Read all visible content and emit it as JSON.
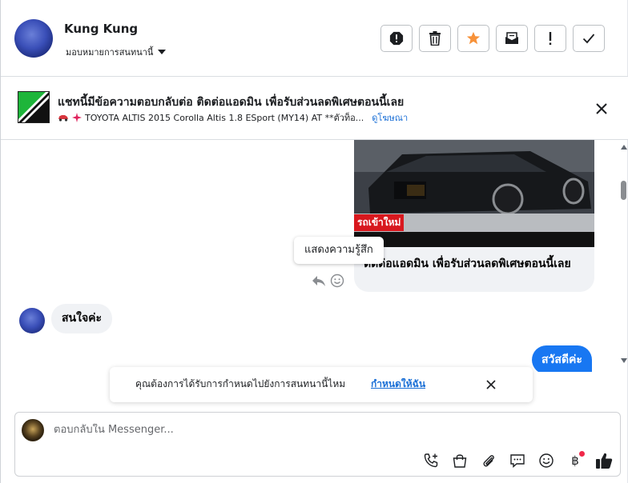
{
  "header": {
    "contact_name": "Kung Kung",
    "assign_label": "มอบหมายการสนทนานี้",
    "tools": [
      "alert-icon",
      "trash-icon",
      "star-icon",
      "mail-icon",
      "exclamation-icon",
      "check-icon"
    ],
    "accent": "#f7923a"
  },
  "banner": {
    "title": "แชทนี้มีข้อความตอบกลับต่อ ติดต่อแอดมิน เพื่อรับส่วนลดพิเศษตอนนี้เลย",
    "subtitle": "TOYOTA ALTIS 2015 Corolla Altis 1.8 ESport (MY14) AT **ตัวท็อ...",
    "view_ad": "ดูโฆษณา"
  },
  "conversation": {
    "car_badge": "รถเข้าใหม่",
    "car_caption": "ติดต่อแอดมิน เพื่อรับส่วนลดพิเศษตอนนี้เลย",
    "tooltip": "แสดงความรู้สึก",
    "incoming": "สนใจค่ะ",
    "outgoing": "สวัสดีค่ะ",
    "outgoing_color": "#1877f2"
  },
  "prompt": {
    "text": "คุณต้องการได้รับการกำหนดไปยังการสนทนานี้ไหม",
    "link": "กำหนดให้ฉัน"
  },
  "composer": {
    "placeholder": "ตอบกลับใน Messenger...",
    "baht_symbol": "฿",
    "icons": [
      "phone-add-icon",
      "bag-icon",
      "paperclip-icon",
      "chat-icon",
      "emoji-icon",
      "baht-icon",
      "like-icon"
    ]
  }
}
